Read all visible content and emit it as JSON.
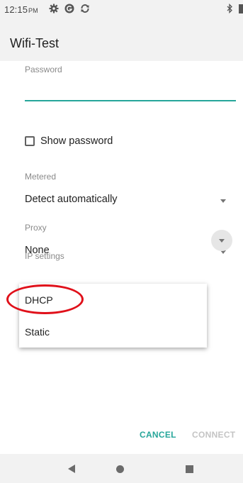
{
  "status_bar": {
    "time": "12:15",
    "ampm": "PM",
    "icons": [
      "settings-gear-icon",
      "g-app-icon",
      "sync-icon"
    ],
    "right_icons": [
      "bluetooth-icon",
      "battery-icon"
    ]
  },
  "toolbar": {
    "title": "Wifi-Test"
  },
  "form": {
    "password_label": "Password",
    "password_value": "",
    "show_password_label": "Show password",
    "show_password_checked": false,
    "metered_label": "Metered",
    "metered_value": "Detect automatically",
    "proxy_label": "Proxy",
    "proxy_value": "None",
    "ip_settings_label": "IP settings"
  },
  "ip_dropdown": {
    "options": [
      "DHCP",
      "Static"
    ],
    "highlighted_option": "DHCP"
  },
  "dialog_buttons": {
    "cancel": "CANCEL",
    "connect": "CONNECT",
    "connect_enabled": false
  },
  "colors": {
    "accent": "#26a69a",
    "highlight_annotation": "#e0101a",
    "disabled_text": "#c4c4c4"
  }
}
